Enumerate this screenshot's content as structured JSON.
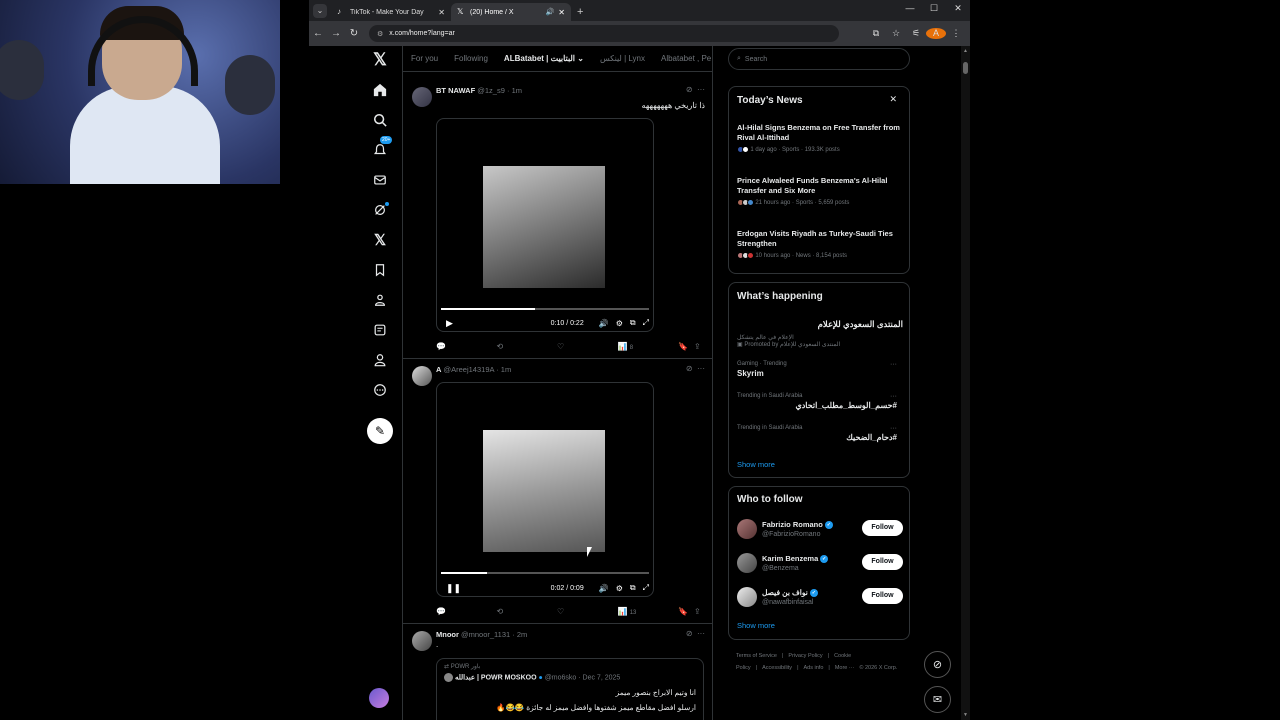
{
  "browser": {
    "tabs": [
      {
        "label": "TikTok - Make Your Day",
        "icon": "tiktok-icon",
        "active": false
      },
      {
        "label": "(20) Home / X",
        "icon": "x-logo-icon",
        "active": true
      }
    ],
    "url": "x.com/home?lang=ar",
    "profile_initial": "A"
  },
  "nav": {
    "notifications_badge": "20+"
  },
  "feed": {
    "tabs": [
      "For you",
      "Following",
      "ALBatabet | البتابيت",
      "لينكس | Lynx",
      "Albatabet , Pe"
    ],
    "active_tab_index": 2,
    "tweets": [
      {
        "name": "BT NAWAF",
        "handle": "@1z_s9",
        "time": "· 1m",
        "text": "ذا تاريخي هههههههه",
        "video_time": "0:10 / 0:22",
        "progress": 0.45,
        "playing": false,
        "views": "8"
      },
      {
        "name": "A",
        "handle": "@Areej14319A",
        "time": "· 1m",
        "text": "",
        "video_time": "0:02 / 0:09",
        "progress": 0.22,
        "playing": true,
        "views": "13"
      },
      {
        "name": "Mnoor",
        "handle": "@mnoor_1131",
        "time": "· 2m",
        "text": ".",
        "quote": {
          "repost_label": "POWR باور",
          "name": "عبدالله | POWR MOSKOO",
          "handle": "@mo6sko",
          "time": "· Dec 7, 2025",
          "line1": "انا وتيم الابراج بنصور ميمز",
          "line2": "ارسلو افضل مقاطع ميمز شفتوها وافضل ميمز له جائزة 😂😂🔥"
        }
      }
    ]
  },
  "sidebar": {
    "search_placeholder": "Search",
    "news": {
      "title": "Today’s News",
      "items": [
        {
          "title": "Al-Hilal Signs Benzema on Free Transfer from Rival Al-Ittihad",
          "meta": "1 day ago · Sports · 193.3K posts"
        },
        {
          "title": "Prince Alwaleed Funds Benzema's Al-Hilal Transfer and Six More",
          "meta": "21 hours ago · Sports · 5,659 posts"
        },
        {
          "title": "Erdogan Visits Riyadh as Turkey-Saudi Ties Strengthen",
          "meta": "10 hours ago · News · 8,154 posts"
        }
      ]
    },
    "happening": {
      "title": "What’s happening",
      "promoted": {
        "name": "المنتدى السعودي للإعلام",
        "sub": "الإعلام في عالم يتشكل",
        "meta": "Promoted by المنتدى السعودي للإعلام"
      },
      "trends": [
        {
          "meta": "Gaming · Trending",
          "name": "Skyrim",
          "rtl": false
        },
        {
          "meta": "Trending in Saudi Arabia",
          "name": "#حسم_الوسط_مطلب_اتحادي",
          "rtl": true
        },
        {
          "meta": "Trending in Saudi Arabia",
          "name": "#دحام_الضحيك",
          "rtl": true
        }
      ],
      "show_more": "Show more"
    },
    "who_to_follow": {
      "title": "Who to follow",
      "users": [
        {
          "name": "Fabrizio Romano",
          "handle": "@FabrizioRomano",
          "button": "Follow"
        },
        {
          "name": "Karim Benzema",
          "handle": "@Benzema",
          "button": "Follow"
        },
        {
          "name": "نواف بن فيصل",
          "handle": "@nawafbinfaisal",
          "button": "Follow"
        }
      ],
      "show_more": "Show more"
    },
    "footer": {
      "links": [
        "Terms of Service",
        "|",
        "Privacy Policy",
        "|",
        "Cookie Policy",
        "|",
        "Accessibility",
        "|",
        "Ads info",
        "|",
        "More ···",
        "© 2026 X Corp."
      ]
    }
  },
  "colors": {
    "accent": "#1d9bf0",
    "background": "#000000",
    "border": "#2f3336",
    "muted": "#71767b"
  }
}
